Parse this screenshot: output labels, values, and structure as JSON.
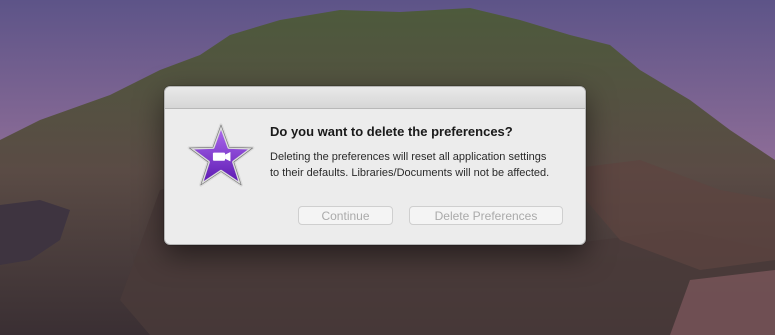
{
  "dialog": {
    "title": "Do you want to delete the preferences?",
    "message": "Deleting the preferences will reset all application settings to their defaults.  Libraries/Documents will not be affected.",
    "continue_label": "Continue",
    "delete_label": "Delete Preferences",
    "icon": "imovie-star-icon"
  },
  "colors": {
    "star_purple": "#7b2ccf",
    "disabled_text": "#aaaaaa",
    "dialog_bg": "#ececec"
  }
}
